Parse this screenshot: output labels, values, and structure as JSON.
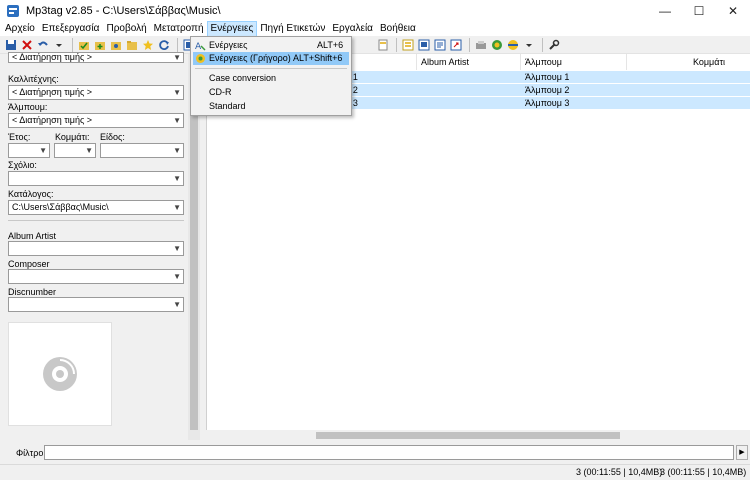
{
  "window": {
    "title": "Mp3tag v2.85  -  C:\\Users\\Σάββας\\Music\\",
    "minimize": "—",
    "maximize": "☐",
    "close": "✕"
  },
  "menu": [
    "Αρχείο",
    "Επεξεργασία",
    "Προβολή",
    "Μετατροπή",
    "Ενέργειες",
    "Πηγή Ετικετών",
    "Εργαλεία",
    "Βοήθεια"
  ],
  "left_panel": {
    "fields": {
      "title_value": "< Διατήρηση τιμής >",
      "artist_label": "Καλλιτέχνης:",
      "artist_value": "< Διατήρηση τιμής >",
      "album_label": "Άλμπουμ:",
      "album_value": "< Διατήρηση τιμής >",
      "year_label": "Έτος:",
      "track_label": "Κομμάτι:",
      "genre_label": "Είδος:",
      "comment_label": "Σχόλιο:",
      "directory_label": "Κατάλογος:",
      "directory_value": "C:\\Users\\Σάββας\\Music\\",
      "album_artist_label": "Album Artist",
      "composer_label": "Composer",
      "discnumber_label": "Discnumber"
    }
  },
  "file_list": {
    "columns": [
      "ης",
      "Album Artist",
      "Άλμπουμ",
      "Κομμάτι"
    ],
    "rows": [
      {
        "artist": "ης 1",
        "album": "Άλμπουμ 1"
      },
      {
        "artist": "ης 2",
        "album": "Άλμπουμ 2"
      },
      {
        "artist": "ης 3",
        "album": "Άλμπουμ 3"
      }
    ]
  },
  "actions_menu": {
    "items": [
      {
        "label": "Ενέργειες",
        "accel": "ALT+6"
      },
      {
        "label": "Ενέργειες (Γρήγορο)",
        "accel": "ALT+Shift+6"
      },
      {
        "label": "Case conversion",
        "accel": ""
      },
      {
        "label": "CD-R",
        "accel": ""
      },
      {
        "label": "Standard",
        "accel": ""
      }
    ]
  },
  "filter": {
    "label": "Φίλτρο:",
    "value": ""
  },
  "status": {
    "selected": "3 (00:11:55 | 10,4MB)",
    "total": "3 (00:11:55 | 10,4MB)"
  },
  "colors": {
    "selection": "#cce8ff",
    "menu_highlight": "#91c9f7"
  }
}
